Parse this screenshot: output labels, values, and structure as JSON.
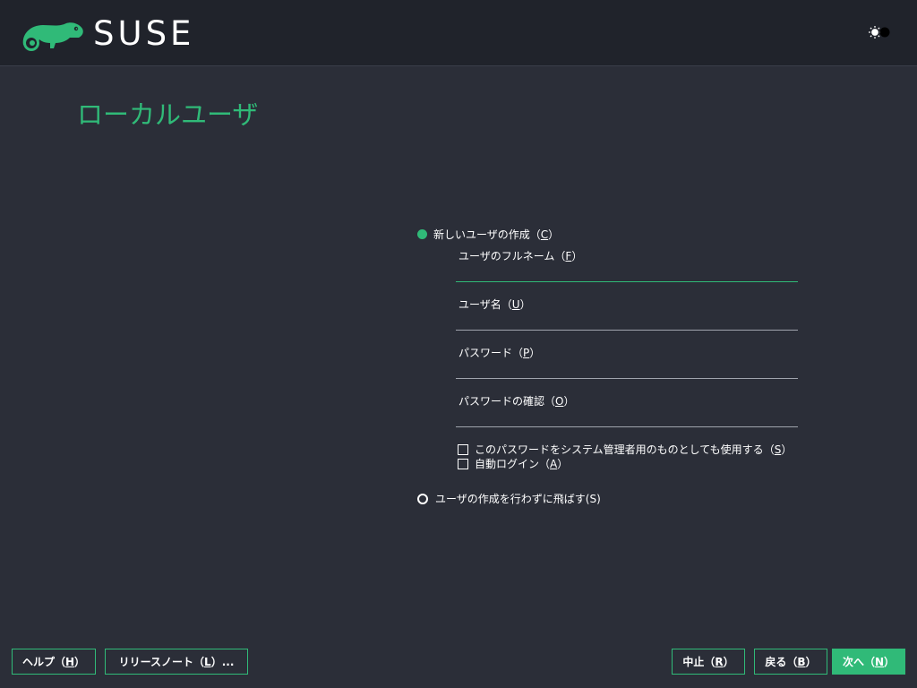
{
  "header": {
    "logo_text": "SUSE",
    "logo_icon": "suse-chameleon-logo",
    "theme_toggle_icon": "sun-moon-toggle-icon"
  },
  "page": {
    "title": "ローカルユーザ"
  },
  "colors": {
    "accent": "#30ba78",
    "background": "#2b2e38",
    "header_background": "#20232b"
  },
  "options": {
    "create_user": {
      "label": "新しいユーザの作成",
      "mnemonic": "C",
      "selected": true
    },
    "skip_user": {
      "label": "ユーザの作成を行わずに飛ばす",
      "mnemonic": "(S)",
      "selected": false
    }
  },
  "fields": {
    "full_name": {
      "label": "ユーザのフルネーム",
      "mnemonic": "F",
      "value": ""
    },
    "username": {
      "label": "ユーザ名",
      "mnemonic": "U",
      "value": ""
    },
    "password": {
      "label": "パスワード",
      "mnemonic": "P",
      "value": ""
    },
    "password_confirm": {
      "label": "パスワードの確認",
      "mnemonic": "O",
      "value": ""
    }
  },
  "checkboxes": {
    "use_for_admin": {
      "label": "このパスワードをシステム管理者用のものとしても使用する",
      "mnemonic": "S",
      "checked": false
    },
    "auto_login": {
      "label": "自動ログイン",
      "mnemonic": "A",
      "checked": false
    }
  },
  "buttons": {
    "help": {
      "label": "ヘルプ",
      "mnemonic": "H",
      "suffix": ""
    },
    "release_notes": {
      "label": "リリースノート",
      "mnemonic": "L",
      "suffix": "..."
    },
    "abort": {
      "label": "中止",
      "mnemonic": "R",
      "suffix": ""
    },
    "back": {
      "label": "戻る",
      "mnemonic": "B",
      "suffix": ""
    },
    "next": {
      "label": "次へ",
      "mnemonic": "N",
      "suffix": ""
    }
  }
}
